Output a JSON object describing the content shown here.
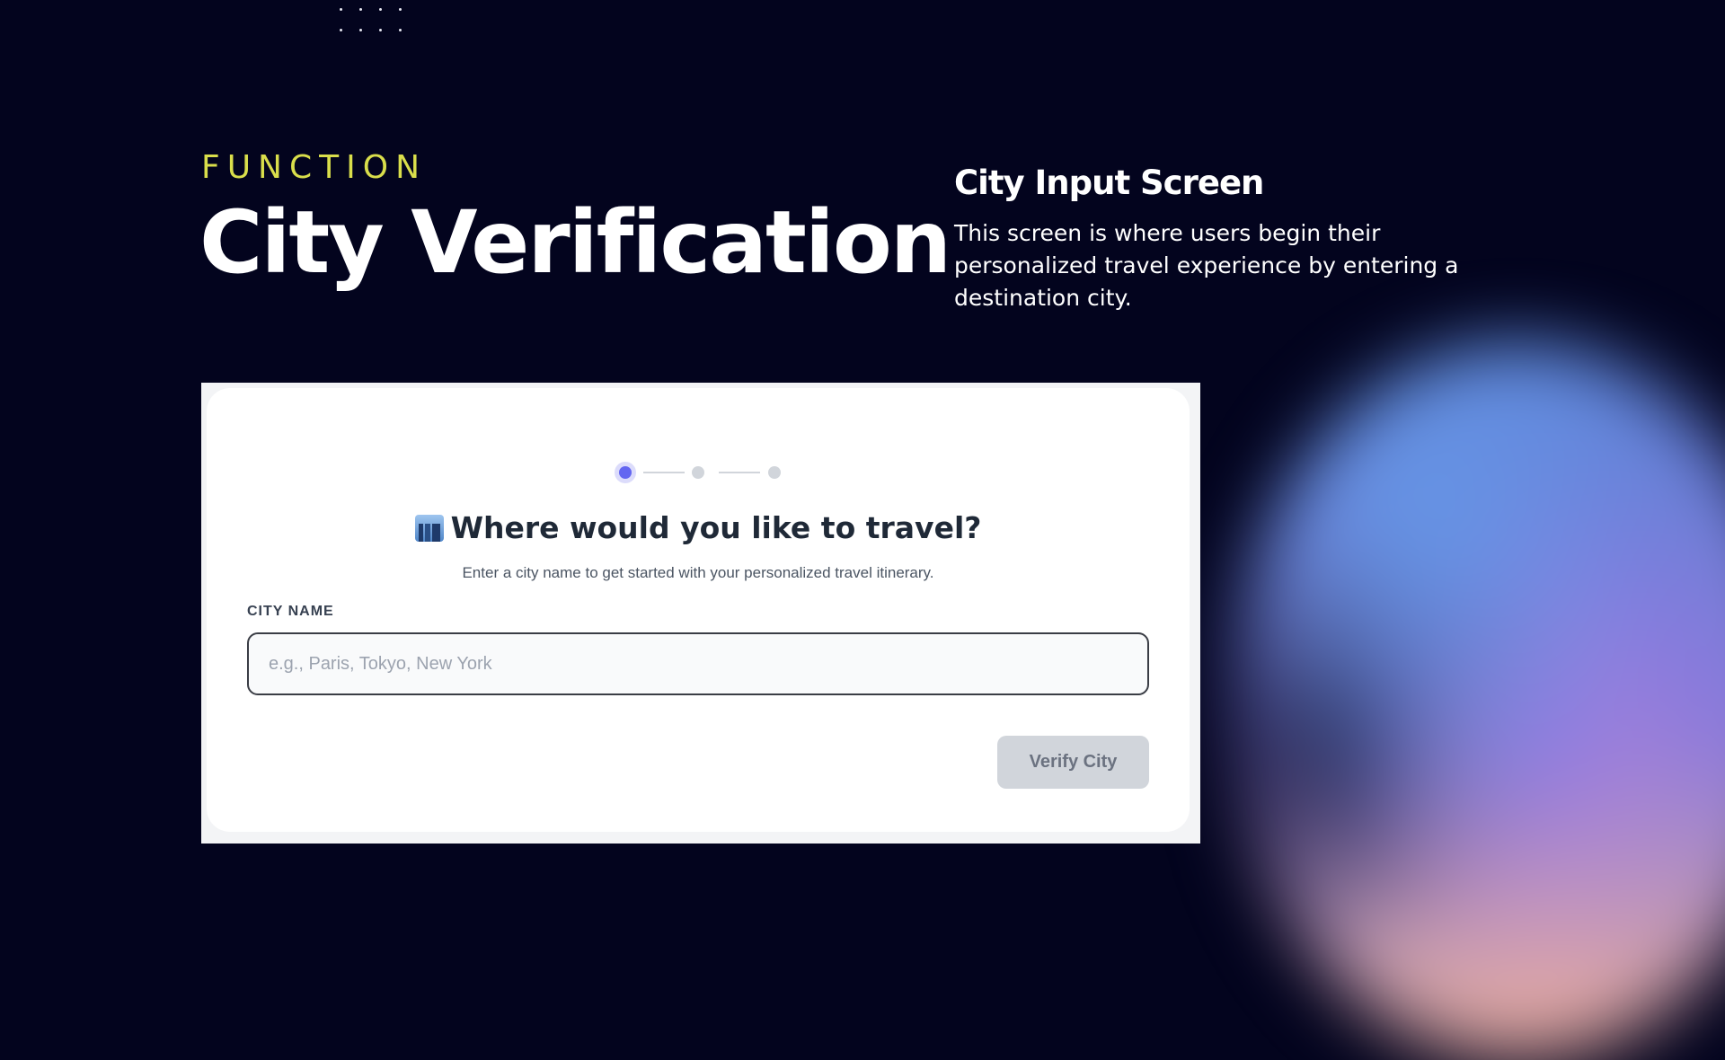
{
  "header": {
    "eyebrow": "FUNCTION",
    "title": "City Verification"
  },
  "screen_info": {
    "title": "City Input Screen",
    "description": "This screen is where users begin their personalized travel experience by entering a destination city."
  },
  "card": {
    "stepper": {
      "total_steps": 3,
      "current_step": 1
    },
    "question_icon": "cityscape-icon",
    "question": "Where would you like to travel?",
    "subtitle": "Enter a city name to get started with your personalized travel itinerary.",
    "field_label": "CITY NAME",
    "city_input": {
      "value": "",
      "placeholder": "e.g., Paris, Tokyo, New York"
    },
    "verify_button": "Verify City"
  },
  "colors": {
    "background": "#03041e",
    "accent_yellow": "#d9de4b",
    "step_active": "#6366f1",
    "button_disabled": "#d1d5db"
  }
}
